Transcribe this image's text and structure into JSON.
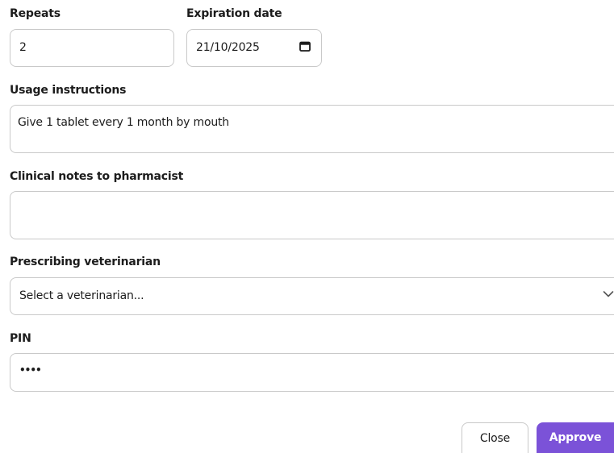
{
  "repeats": {
    "label": "Repeats",
    "value": "2"
  },
  "expiration": {
    "label": "Expiration date",
    "value": "21/10/2025",
    "icon": "calendar-icon"
  },
  "usage": {
    "label": "Usage instructions",
    "value": "Give 1 tablet every 1 month by mouth"
  },
  "clinical_notes": {
    "label": "Clinical notes to pharmacist",
    "value": ""
  },
  "veterinarian": {
    "label": "Prescribing veterinarian",
    "selected": "Select a veterinarian...",
    "icon": "chevron-down-icon"
  },
  "pin": {
    "label": "PIN",
    "value": "••••"
  },
  "actions": {
    "close_label": "Close",
    "approve_label": "Approve",
    "approve_color": "#7b52d8"
  }
}
